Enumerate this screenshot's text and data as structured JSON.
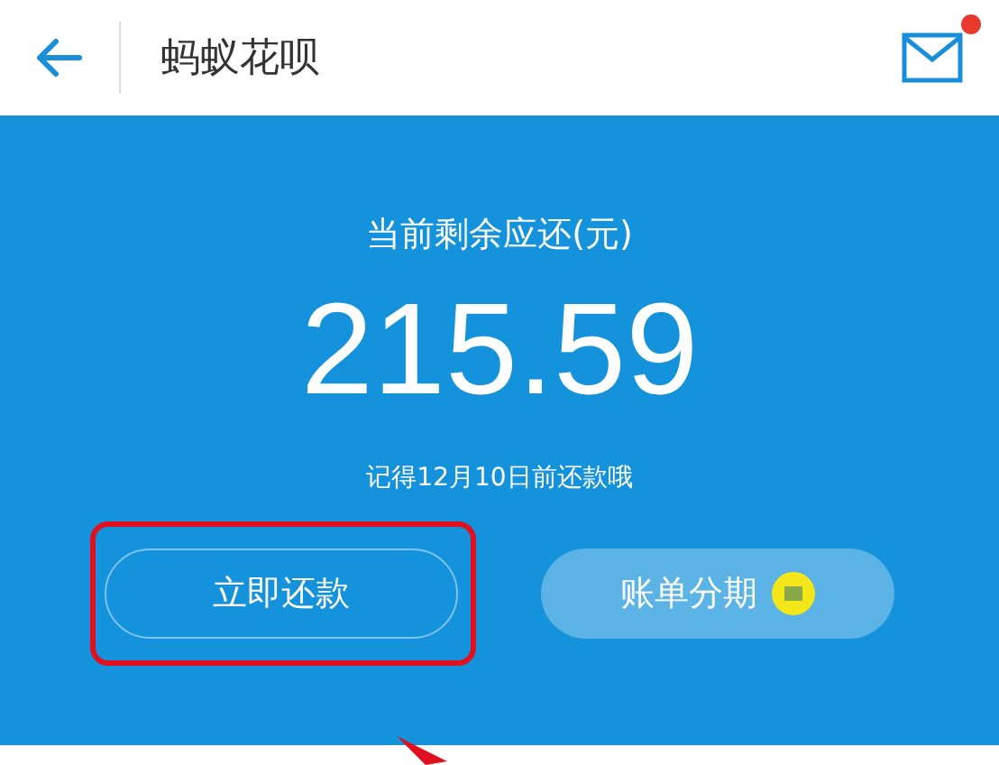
{
  "header": {
    "title": "蚂蚁花呗",
    "has_unread": true
  },
  "summary": {
    "label": "当前剩余应还(元)",
    "amount": "215.59",
    "note": "记得12月10日前还款哦"
  },
  "buttons": [
    {
      "label": "立即还款",
      "kind": "outline",
      "highlighted": true
    },
    {
      "label": "账单分期",
      "kind": "filled",
      "highlighted": false
    }
  ]
}
